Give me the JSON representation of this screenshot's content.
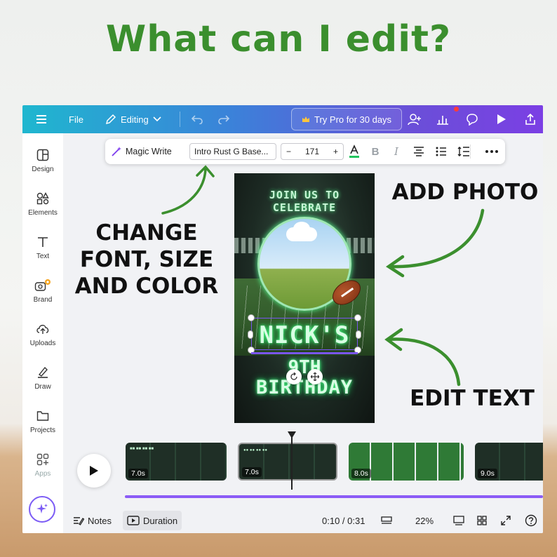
{
  "heading": "What can I edit?",
  "topbar": {
    "file_label": "File",
    "editing_label": "Editing",
    "pro_label": "Try Pro for 30 days"
  },
  "sidebar": {
    "items": [
      {
        "label": "Design",
        "icon": "design-icon"
      },
      {
        "label": "Elements",
        "icon": "elements-icon"
      },
      {
        "label": "Text",
        "icon": "text-icon"
      },
      {
        "label": "Brand",
        "icon": "brand-icon"
      },
      {
        "label": "Uploads",
        "icon": "uploads-icon"
      },
      {
        "label": "Draw",
        "icon": "draw-icon"
      },
      {
        "label": "Projects",
        "icon": "projects-icon"
      },
      {
        "label": "Apps",
        "icon": "apps-icon"
      }
    ]
  },
  "toolbar": {
    "magic_write": "Magic Write",
    "font_name": "Intro Rust G Base...",
    "font_size": "171",
    "minus": "−",
    "plus": "+"
  },
  "design": {
    "arch_text": "JOIN US TO CELEBRATE",
    "name": "NICK'S",
    "age": "9TH",
    "birthday": "BIRTHDAY"
  },
  "annotations": {
    "add_photo": "ADD PHOTO",
    "change_font": "CHANGE\nFONT, SIZE\nAND COLOR",
    "edit_text": "EDIT TEXT"
  },
  "timeline": {
    "clips": [
      {
        "duration": "7.0s"
      },
      {
        "duration": "7.0s"
      },
      {
        "duration": "8.0s"
      },
      {
        "duration": "9.0s"
      }
    ]
  },
  "bottombar": {
    "notes_label": "Notes",
    "duration_label": "Duration",
    "time": "0:10 / 0:31",
    "zoom": "22%"
  },
  "colors": {
    "heading_green": "#3b8f2e",
    "arrow_green": "#3b8f2e",
    "selection_purple": "#7a55f0",
    "neon_green": "#4dff8a"
  }
}
